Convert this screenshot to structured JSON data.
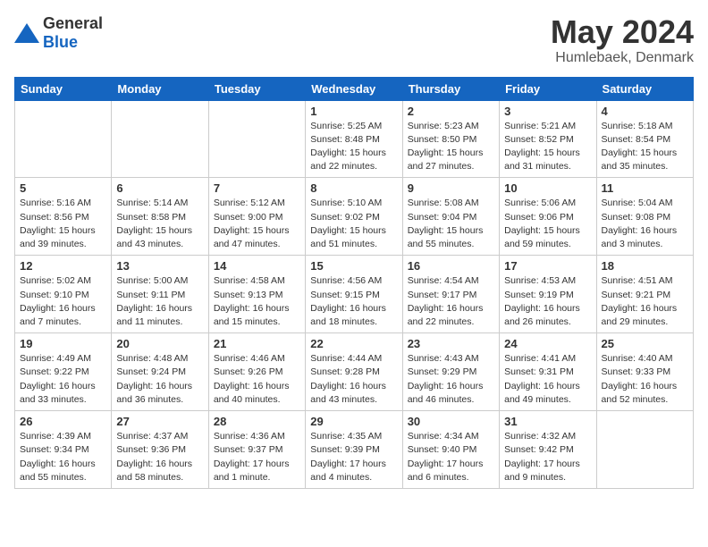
{
  "header": {
    "logo": {
      "general": "General",
      "blue": "Blue"
    },
    "title": "May 2024",
    "location": "Humlebaek, Denmark"
  },
  "calendar": {
    "weekdays": [
      "Sunday",
      "Monday",
      "Tuesday",
      "Wednesday",
      "Thursday",
      "Friday",
      "Saturday"
    ],
    "weeks": [
      [
        null,
        null,
        null,
        {
          "day": 1,
          "sunrise": "5:25 AM",
          "sunset": "8:48 PM",
          "daylight": "15 hours and 22 minutes."
        },
        {
          "day": 2,
          "sunrise": "5:23 AM",
          "sunset": "8:50 PM",
          "daylight": "15 hours and 27 minutes."
        },
        {
          "day": 3,
          "sunrise": "5:21 AM",
          "sunset": "8:52 PM",
          "daylight": "15 hours and 31 minutes."
        },
        {
          "day": 4,
          "sunrise": "5:18 AM",
          "sunset": "8:54 PM",
          "daylight": "15 hours and 35 minutes."
        }
      ],
      [
        {
          "day": 5,
          "sunrise": "5:16 AM",
          "sunset": "8:56 PM",
          "daylight": "15 hours and 39 minutes."
        },
        {
          "day": 6,
          "sunrise": "5:14 AM",
          "sunset": "8:58 PM",
          "daylight": "15 hours and 43 minutes."
        },
        {
          "day": 7,
          "sunrise": "5:12 AM",
          "sunset": "9:00 PM",
          "daylight": "15 hours and 47 minutes."
        },
        {
          "day": 8,
          "sunrise": "5:10 AM",
          "sunset": "9:02 PM",
          "daylight": "15 hours and 51 minutes."
        },
        {
          "day": 9,
          "sunrise": "5:08 AM",
          "sunset": "9:04 PM",
          "daylight": "15 hours and 55 minutes."
        },
        {
          "day": 10,
          "sunrise": "5:06 AM",
          "sunset": "9:06 PM",
          "daylight": "15 hours and 59 minutes."
        },
        {
          "day": 11,
          "sunrise": "5:04 AM",
          "sunset": "9:08 PM",
          "daylight": "16 hours and 3 minutes."
        }
      ],
      [
        {
          "day": 12,
          "sunrise": "5:02 AM",
          "sunset": "9:10 PM",
          "daylight": "16 hours and 7 minutes."
        },
        {
          "day": 13,
          "sunrise": "5:00 AM",
          "sunset": "9:11 PM",
          "daylight": "16 hours and 11 minutes."
        },
        {
          "day": 14,
          "sunrise": "4:58 AM",
          "sunset": "9:13 PM",
          "daylight": "16 hours and 15 minutes."
        },
        {
          "day": 15,
          "sunrise": "4:56 AM",
          "sunset": "9:15 PM",
          "daylight": "16 hours and 18 minutes."
        },
        {
          "day": 16,
          "sunrise": "4:54 AM",
          "sunset": "9:17 PM",
          "daylight": "16 hours and 22 minutes."
        },
        {
          "day": 17,
          "sunrise": "4:53 AM",
          "sunset": "9:19 PM",
          "daylight": "16 hours and 26 minutes."
        },
        {
          "day": 18,
          "sunrise": "4:51 AM",
          "sunset": "9:21 PM",
          "daylight": "16 hours and 29 minutes."
        }
      ],
      [
        {
          "day": 19,
          "sunrise": "4:49 AM",
          "sunset": "9:22 PM",
          "daylight": "16 hours and 33 minutes."
        },
        {
          "day": 20,
          "sunrise": "4:48 AM",
          "sunset": "9:24 PM",
          "daylight": "16 hours and 36 minutes."
        },
        {
          "day": 21,
          "sunrise": "4:46 AM",
          "sunset": "9:26 PM",
          "daylight": "16 hours and 40 minutes."
        },
        {
          "day": 22,
          "sunrise": "4:44 AM",
          "sunset": "9:28 PM",
          "daylight": "16 hours and 43 minutes."
        },
        {
          "day": 23,
          "sunrise": "4:43 AM",
          "sunset": "9:29 PM",
          "daylight": "16 hours and 46 minutes."
        },
        {
          "day": 24,
          "sunrise": "4:41 AM",
          "sunset": "9:31 PM",
          "daylight": "16 hours and 49 minutes."
        },
        {
          "day": 25,
          "sunrise": "4:40 AM",
          "sunset": "9:33 PM",
          "daylight": "16 hours and 52 minutes."
        }
      ],
      [
        {
          "day": 26,
          "sunrise": "4:39 AM",
          "sunset": "9:34 PM",
          "daylight": "16 hours and 55 minutes."
        },
        {
          "day": 27,
          "sunrise": "4:37 AM",
          "sunset": "9:36 PM",
          "daylight": "16 hours and 58 minutes."
        },
        {
          "day": 28,
          "sunrise": "4:36 AM",
          "sunset": "9:37 PM",
          "daylight": "17 hours and 1 minute."
        },
        {
          "day": 29,
          "sunrise": "4:35 AM",
          "sunset": "9:39 PM",
          "daylight": "17 hours and 4 minutes."
        },
        {
          "day": 30,
          "sunrise": "4:34 AM",
          "sunset": "9:40 PM",
          "daylight": "17 hours and 6 minutes."
        },
        {
          "day": 31,
          "sunrise": "4:32 AM",
          "sunset": "9:42 PM",
          "daylight": "17 hours and 9 minutes."
        },
        null
      ]
    ]
  }
}
